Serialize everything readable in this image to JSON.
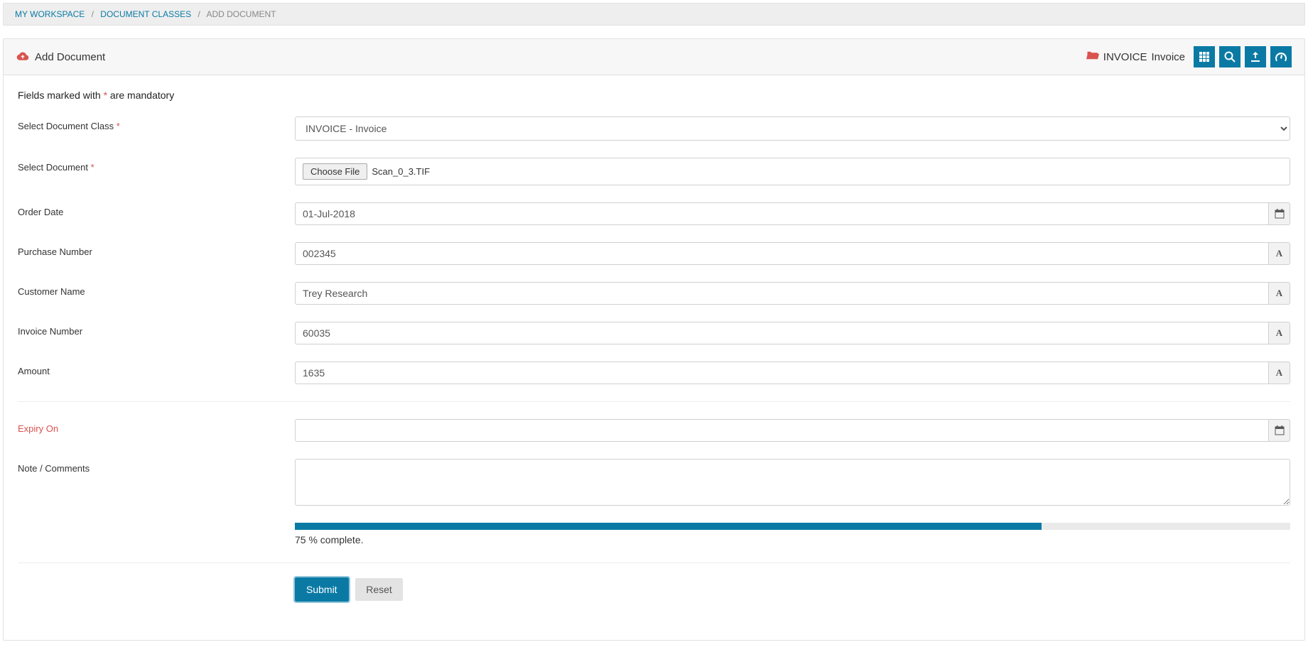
{
  "breadcrumb": {
    "items": [
      "MY WORKSPACE",
      "DOCUMENT CLASSES"
    ],
    "current": "ADD DOCUMENT"
  },
  "panel": {
    "title": "Add Document",
    "docclass_code": "INVOICE",
    "docclass_name": "Invoice"
  },
  "mandatory_note": {
    "prefix": "Fields marked with ",
    "star": "*",
    "suffix": " are mandatory"
  },
  "form": {
    "document_class": {
      "label": "Select Document Class ",
      "required_star": "*",
      "value": "INVOICE - Invoice"
    },
    "document_file": {
      "label": "Select Document ",
      "required_star": "*",
      "button": "Choose File",
      "filename": "Scan_0_3.TIF"
    },
    "order_date": {
      "label": "Order Date",
      "value": "01-Jul-2018"
    },
    "purchase_number": {
      "label": "Purchase Number",
      "value": "002345"
    },
    "customer_name": {
      "label": "Customer Name",
      "value": "Trey Research"
    },
    "invoice_number": {
      "label": "Invoice Number",
      "value": "60035"
    },
    "amount": {
      "label": "Amount",
      "value": "1635"
    },
    "expiry_on": {
      "label": "Expiry On",
      "value": ""
    },
    "note": {
      "label": "Note / Comments",
      "value": ""
    }
  },
  "progress": {
    "percent": 75,
    "text": "75 % complete."
  },
  "actions": {
    "submit": "Submit",
    "reset": "Reset"
  }
}
